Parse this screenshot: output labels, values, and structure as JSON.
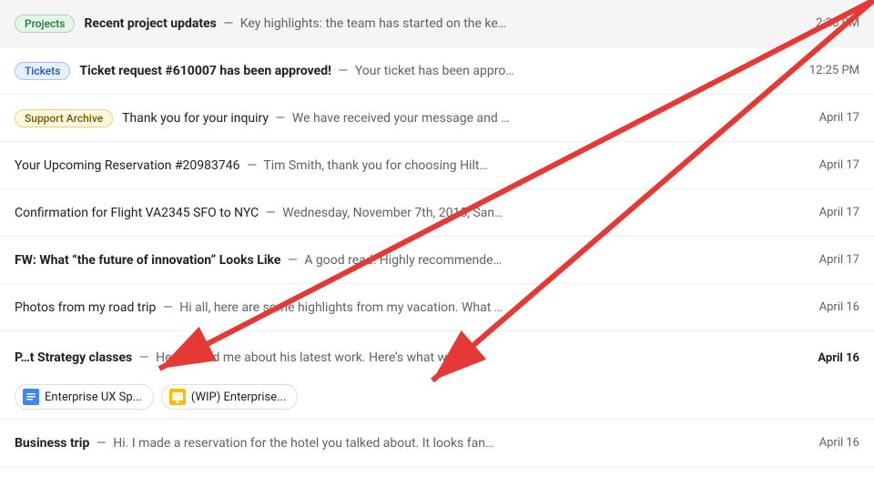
{
  "emails": [
    {
      "id": "email-1",
      "tag": {
        "label": "Projects",
        "type": "projects"
      },
      "subject": "Recent project updates",
      "subject_bold": true,
      "preview": "Key highlights: the team has started on the ke…",
      "timestamp": "2:25 PM",
      "timestamp_bold": false
    },
    {
      "id": "email-2",
      "tag": {
        "label": "Tickets",
        "type": "tickets"
      },
      "subject": "Ticket request #610007 has been approved!",
      "subject_bold": true,
      "preview": "Your ticket has been appro…",
      "timestamp": "12:25 PM",
      "timestamp_bold": false
    },
    {
      "id": "email-3",
      "tag": {
        "label": "Support Archive",
        "type": "support"
      },
      "subject": "Thank you for your inquiry",
      "subject_bold": false,
      "preview": "We have received your message and …",
      "timestamp": "April 17",
      "timestamp_bold": false
    },
    {
      "id": "email-4",
      "tag": null,
      "subject": "Your Upcoming Reservation #20983746",
      "subject_bold": false,
      "preview": "Tim Smith, thank you for choosing Hilt…",
      "timestamp": "April 17",
      "timestamp_bold": false
    },
    {
      "id": "email-5",
      "tag": null,
      "subject": "Confirmation for Flight VA2345 SFO to NYC",
      "subject_bold": false,
      "preview": "Wednesday, November 7th, 2015, San…",
      "timestamp": "April 17",
      "timestamp_bold": false
    },
    {
      "id": "email-6",
      "tag": null,
      "subject": "FW: What “the future of innovation” Looks Like",
      "subject_bold": true,
      "preview": "A good read! Highly recommende…",
      "timestamp": "April 17",
      "timestamp_bold": false
    },
    {
      "id": "email-7",
      "tag": null,
      "subject": "Photos from my road trip",
      "subject_bold": false,
      "preview": "Hi all, here are some highlights from my vacation. What …",
      "timestamp": "April 16",
      "timestamp_bold": false
    },
    {
      "id": "email-8",
      "tag": null,
      "subject": "Strategy classes",
      "subject_bold": true,
      "preview": "He emailed me about his latest work. Here’s what we rev…",
      "timestamp": "April 16",
      "timestamp_bold": true,
      "has_attachments": true,
      "subject_prefix": "P…t "
    },
    {
      "id": "email-9",
      "tag": null,
      "subject": "Business trip",
      "subject_bold": true,
      "preview": "Hi. I made a reservation for the hotel you talked about. It looks fan…",
      "timestamp": "April 16",
      "timestamp_bold": false
    }
  ],
  "attachments": [
    {
      "label": "Enterprise UX Sp...",
      "icon_type": "docs"
    },
    {
      "label": "(WIP) Enterprise...",
      "icon_type": "slides"
    }
  ]
}
